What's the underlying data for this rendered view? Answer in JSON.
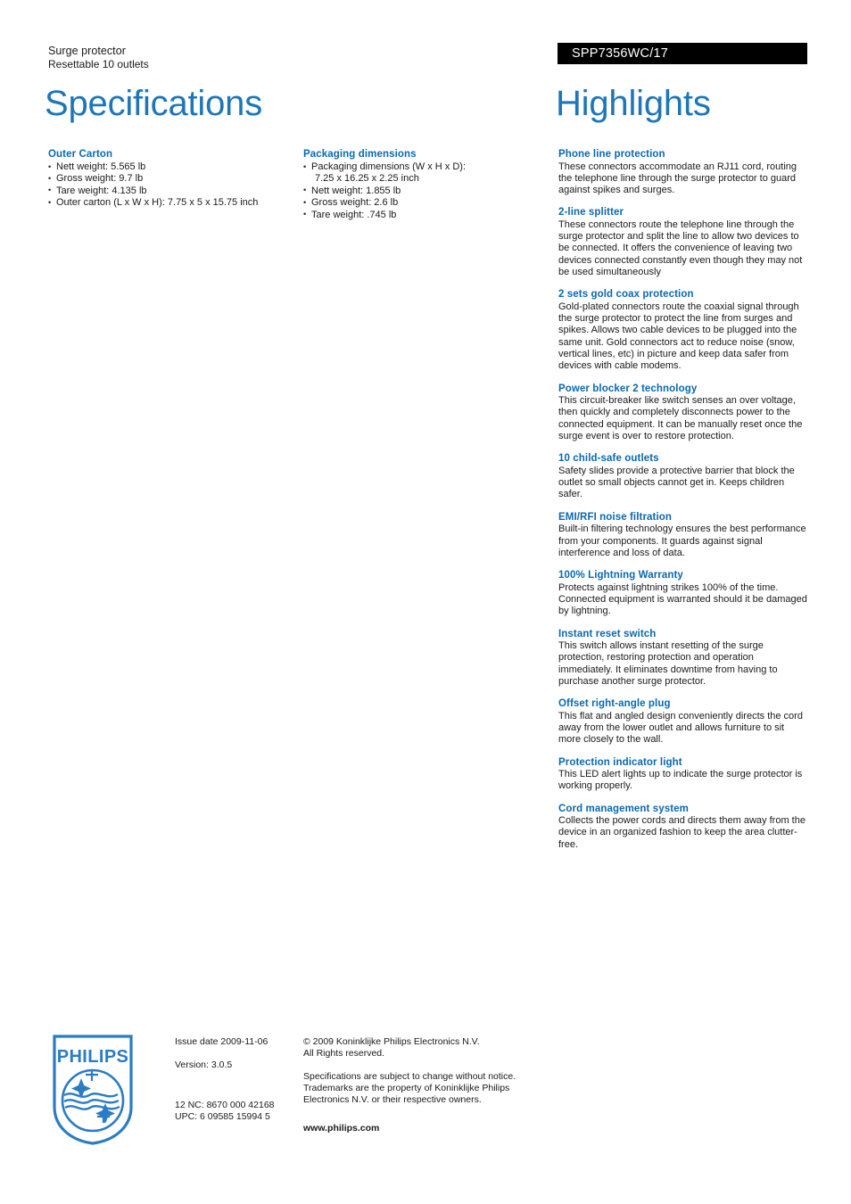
{
  "header": {
    "product_name": "Surge protector",
    "product_subtitle": "Resettable 10 outlets",
    "product_code": "SPP7356WC/17",
    "title_left": "Specifications",
    "title_right": "Highlights"
  },
  "specifications": [
    {
      "heading": "Outer Carton",
      "items": [
        "Nett weight: 5.565 lb",
        "Gross weight: 9.7 lb",
        "Tare weight: 4.135 lb",
        "Outer carton (L x W x H): 7.75 x 5 x 15.75 inch"
      ]
    },
    {
      "heading": "Packaging dimensions",
      "items": [
        "Packaging dimensions (W x H x D):",
        "7.25 x 16.25 x 2.25 inch",
        "Nett weight: 1.855 lb",
        "Gross weight: 2.6 lb",
        "Tare weight: .745 lb"
      ]
    }
  ],
  "highlights": [
    {
      "heading": "Phone line protection",
      "body": "These connectors accommodate an RJ11 cord, routing the telephone line through the surge protector to guard against spikes and surges."
    },
    {
      "heading": "2-line splitter",
      "body": "These connectors route the telephone line through the surge protector and split the line to allow two devices to be connected. It offers the convenience of leaving two devices connected constantly even though they may not be used simultaneously"
    },
    {
      "heading": "2 sets gold coax protection",
      "body": "Gold-plated connectors route the coaxial signal through the surge protector to protect the line from surges and spikes. Allows two cable devices to be plugged into the same unit. Gold connectors act to reduce noise (snow, vertical lines, etc) in picture and keep data safer from devices with cable modems."
    },
    {
      "heading": "Power blocker 2 technology",
      "body": "This circuit-breaker like switch senses an over voltage, then quickly and completely disconnects power to the connected equipment. It can be manually reset once the surge event is over to restore protection."
    },
    {
      "heading": "10 child-safe outlets",
      "body": "Safety slides provide a protective barrier that block the outlet so small objects cannot get in. Keeps children safer."
    },
    {
      "heading": "EMI/RFI noise filtration",
      "body": "Built-in filtering technology ensures the best performance from your components. It guards against signal interference and loss of data."
    },
    {
      "heading": "100% Lightning Warranty",
      "body": "Protects against lightning strikes 100% of the time. Connected equipment is warranted should it be damaged by lightning."
    },
    {
      "heading": "Instant reset switch",
      "body": "This switch allows instant resetting of the surge protection, restoring protection and operation immediately. It eliminates downtime from having to purchase another surge protector."
    },
    {
      "heading": "Offset right-angle plug",
      "body": "This flat and angled design conveniently directs the cord away from the lower outlet and allows furniture to sit more closely to the wall."
    },
    {
      "heading": "Protection indicator light",
      "body": "This LED alert lights up to indicate the surge protector is working properly."
    },
    {
      "heading": "Cord management system",
      "body": "Collects the power cords and directs them away from the device in an organized fashion to keep the area clutter-free."
    }
  ],
  "footer": {
    "logo_wordmark": "PHILIPS",
    "issue_date": "Issue date 2009-11-06",
    "version": "Version: 3.0.5",
    "nc_code": "12 NC: 8670 000 42168",
    "upc_code": "UPC: 6 09585 15994 5",
    "copyright_line1": "© 2009 Koninklijke Philips Electronics N.V.",
    "copyright_line2": "All Rights reserved.",
    "disclaimer_line1": "Specifications are subject to change without notice.",
    "disclaimer_line2": "Trademarks are the property of Koninklijke Philips",
    "disclaimer_line3": "Electronics N.V. or their respective owners.",
    "website": "www.philips.com"
  },
  "colors": {
    "title_blue": "#1e76b8",
    "heading_blue": "#0b68b0",
    "code_bar_bg": "#000000",
    "logo_blue": "#2b7cc4"
  }
}
